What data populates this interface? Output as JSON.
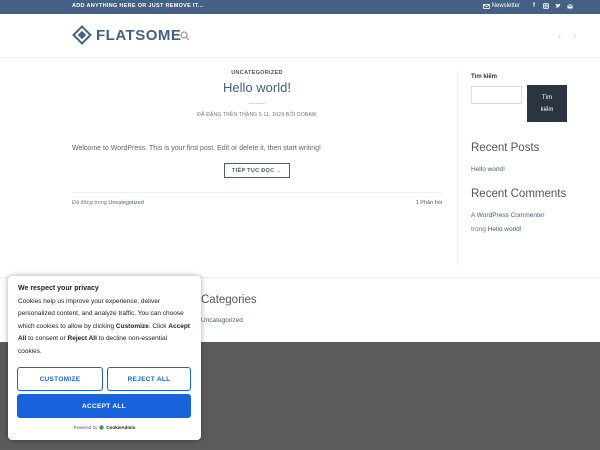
{
  "topbar": {
    "promo": "ADD ANYTHING HERE OR JUST REMOVE IT...",
    "newsletter": "Newsletter",
    "social_icons": [
      "facebook-icon",
      "instagram-icon",
      "twitter-icon",
      "email-icon"
    ]
  },
  "header": {
    "logo_text": "FLATSOME",
    "search_icon": "search-icon",
    "prev_icon": "‹",
    "next_icon": "›"
  },
  "post": {
    "category": "UNCATEGORIZED",
    "title": "Hello world!",
    "meta": "ĐĂ ĐĂNG TRÊN THÁNG 5 11, 2024 BỞI DOBAW",
    "excerpt": "Welcome to WordPress. This is your first post. Edit or delete it, then start writing!",
    "read_more": "TIẾP TỤC ĐỌC →",
    "posted_in_prefix": "Đã đăng trong",
    "posted_in_category": "Uncategorized",
    "comment_link": "1 Phản hồi"
  },
  "sidebar": {
    "search_label": "Tìm kiếm",
    "search_button_line1": "Tìm",
    "search_button_line2": "kiếm",
    "recent_posts_heading": "Recent Posts",
    "recent_post_1": "Hello world!",
    "recent_comments_heading": "Recent Comments",
    "comment_author": "A WordPress Commenter",
    "comment_on": "trong",
    "comment_post": "Hello world!"
  },
  "footer": {
    "categories_heading": "Categories",
    "category_1": "Uncategorized"
  },
  "cookie": {
    "title": "We respect your privacy",
    "body_1": "Cookies help us improve your experience, deliver personalized content, and analyze traffic. You can choose which cookies to allow by clicking ",
    "body_customize": "Customize",
    "body_2": ". Click ",
    "body_accept": "Accept All",
    "body_3": " to consent or ",
    "body_reject": "Reject All",
    "body_4": " to decline non-essential cookies.",
    "customize_button": "CUSTOMIZE",
    "reject_button": "REJECT ALL",
    "accept_button": "ACCEPT ALL",
    "powered_by": "Powered by",
    "powered_brand": "CookieAdmin"
  },
  "colors": {
    "brand": "#446084",
    "topbar": "#446084",
    "sidebar_button": "#2a3541",
    "accept": "#1863dc",
    "footer_dark": "#5b5b5b"
  }
}
